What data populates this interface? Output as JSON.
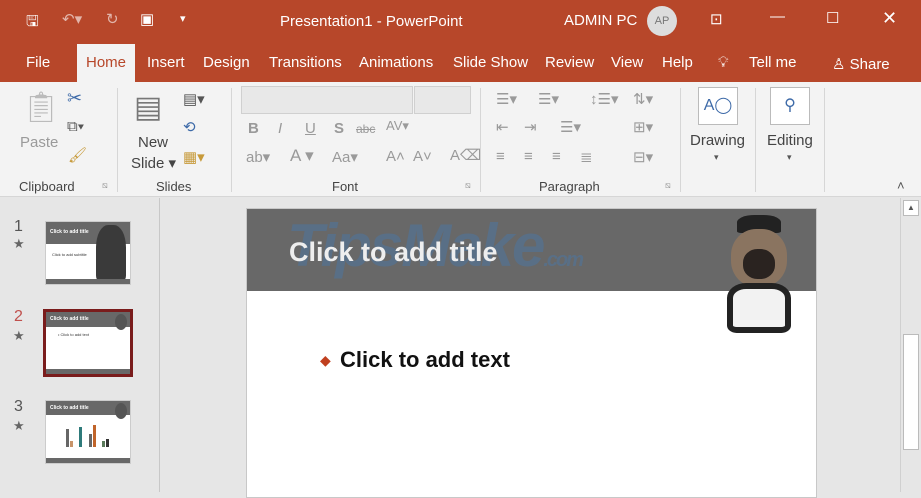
{
  "titlebar": {
    "title": "Presentation1  -  PowerPoint",
    "user": "ADMIN PC",
    "avatar": "AP"
  },
  "tabs": [
    "File",
    "Home",
    "Insert",
    "Design",
    "Transitions",
    "Animations",
    "Slide Show",
    "Review",
    "View",
    "Help"
  ],
  "tell_me": "Tell me",
  "share": "Share",
  "ribbon": {
    "clipboard": {
      "label": "Clipboard",
      "paste": "Paste"
    },
    "slides": {
      "label": "Slides",
      "new_slide_1": "New",
      "new_slide_2": "Slide"
    },
    "font": {
      "label": "Font",
      "font_name": "",
      "font_size": ""
    },
    "paragraph": {
      "label": "Paragraph"
    },
    "drawing": "Drawing",
    "editing": "Editing"
  },
  "thumbnails": [
    {
      "num": "1",
      "title": "Click to add title",
      "body": "Click to add subtitle"
    },
    {
      "num": "2",
      "title": "Click to add title",
      "body": "• Click to add text"
    },
    {
      "num": "3",
      "title": "Click to add title",
      "body": ""
    }
  ],
  "slide": {
    "title": "Click to add title",
    "bullet": "Click to add text",
    "watermark": "TipsMake.com"
  },
  "colors": {
    "accent": "#b7472a",
    "selected": "#7a1c1c",
    "header": "#686868"
  }
}
